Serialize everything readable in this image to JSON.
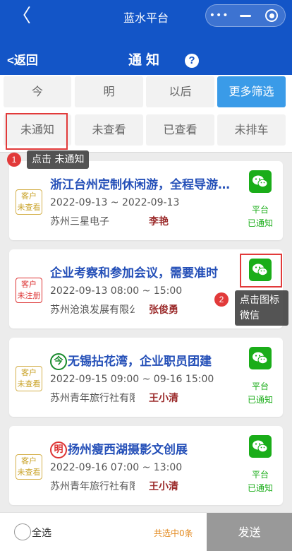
{
  "app": {
    "title": "蓝水平台",
    "back_glyph": "〈",
    "menu_dots": "•••"
  },
  "nav": {
    "back_label": "<返回",
    "title": "通知",
    "help": "?"
  },
  "filters": {
    "row1": [
      "今",
      "明",
      "以后",
      "更多筛选"
    ],
    "row2": [
      "未通知",
      "未查看",
      "已查看",
      "未排车"
    ]
  },
  "hints": {
    "hint1": {
      "num": "1",
      "text": "点击 未通知"
    },
    "hint2": {
      "num": "2",
      "line1": "点击图标",
      "line2": "微信"
    }
  },
  "cards": [
    {
      "tag_line1": "客户",
      "tag_line2": "未查看",
      "tag_color": "yellow",
      "day_badge": "",
      "title": "浙江台州定制休闲游，全程导游陪同",
      "date": "2022-09-13 ~ 2022-09-13",
      "company": "苏州三星电子",
      "person": "李艳",
      "status_line1": "平台",
      "status_line2": "已通知",
      "icon": "wechat-icon"
    },
    {
      "tag_line1": "客户",
      "tag_line2": "未注册",
      "tag_color": "red",
      "day_badge": "",
      "title": "企业考察和参加会议，需要准时",
      "date": "2022-09-13 08:00 ~ 15:00",
      "company": "苏州沧浪发展有限公司",
      "person": "张俊勇",
      "status_line1": "",
      "status_line2": "",
      "icon": "wechat-icon"
    },
    {
      "tag_line1": "客户",
      "tag_line2": "未查看",
      "tag_color": "yellow",
      "day_badge": "今",
      "title": "无锡拈花湾，企业职员团建",
      "date": "2022-09-15 09:00 ~ 09-16 15:00",
      "company": "苏州青年旅行社有限公司",
      "person": "王小清",
      "status_line1": "平台",
      "status_line2": "已通知",
      "icon": "wechat-icon"
    },
    {
      "tag_line1": "客户",
      "tag_line2": "未查看",
      "tag_color": "yellow",
      "day_badge": "明",
      "title": "扬州瘦西湖摄影文创展",
      "date": "2022-09-16 07:00 ~ 13:00",
      "company": "苏州青年旅行社有限公司",
      "person": "王小清",
      "status_line1": "平台",
      "status_line2": "已通知",
      "icon": "wechat-icon"
    }
  ],
  "footer": {
    "select_all": "全选",
    "selected_count": "共选中0条",
    "send": "发送"
  },
  "colors": {
    "brand_blue": "#1355c7",
    "accent_blue": "#3a9be8",
    "wechat_green": "#1aad19",
    "highlight_red": "#e23a3a",
    "count_orange": "#e38a1f"
  }
}
